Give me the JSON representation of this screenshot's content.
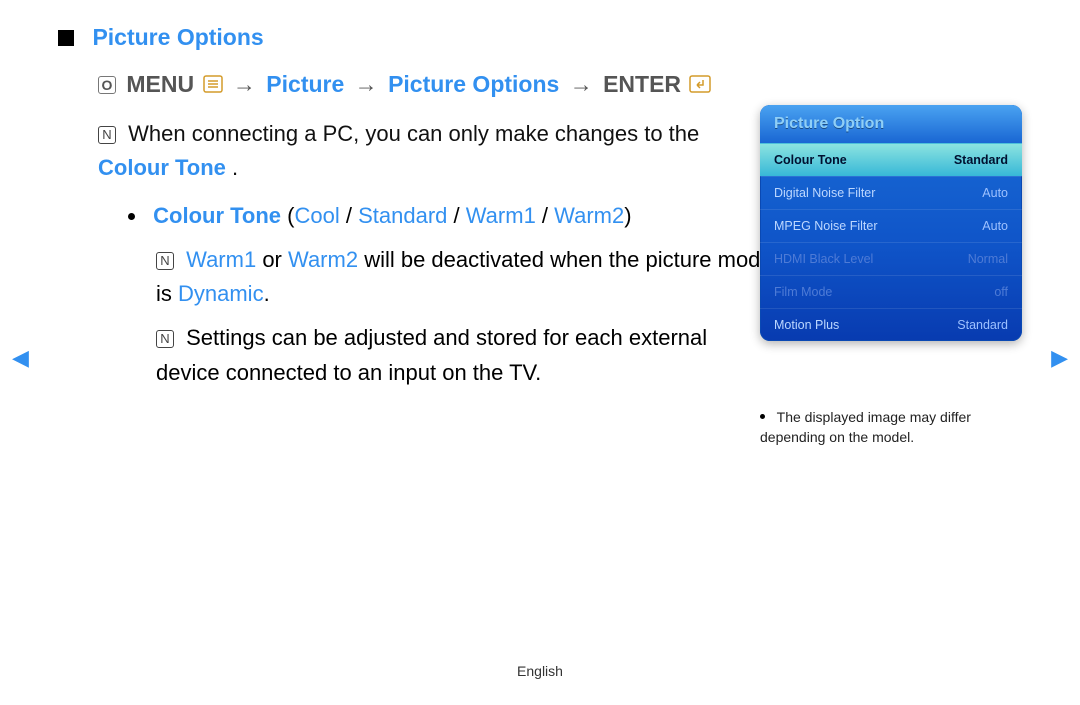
{
  "heading": "Picture Options",
  "path": {
    "menu_label": "MENU",
    "crumb1": "Picture",
    "crumb2": "Picture Options",
    "enter_label": "ENTER",
    "arrow": "→"
  },
  "note1_prefix": "When connecting a PC, you can only make changes to the ",
  "note1_highlight": "Colour Tone",
  "note1_suffix": ".",
  "bullet": {
    "label": "Colour Tone",
    "open": " (",
    "opt1": "Cool",
    "sep": " / ",
    "opt2": "Standard",
    "opt3": "Warm1",
    "opt4": "Warm2",
    "close": ")"
  },
  "sub1_a": "Warm1",
  "sub1_mid": " or ",
  "sub1_b": "Warm2",
  "sub1_rest": " will be deactivated when the picture mode is ",
  "sub1_dynamic": "Dynamic",
  "sub1_end": ".",
  "sub2": "Settings can be adjusted and stored for each external device connected to an input on the TV.",
  "panel": {
    "title": "Picture Option",
    "rows": [
      {
        "label": "Colour Tone",
        "value": "Standard",
        "selected": true,
        "dim": false
      },
      {
        "label": "Digital Noise Filter",
        "value": "Auto",
        "selected": false,
        "dim": false
      },
      {
        "label": "MPEG Noise Filter",
        "value": "Auto",
        "selected": false,
        "dim": false
      },
      {
        "label": "HDMI Black Level",
        "value": "Normal",
        "selected": false,
        "dim": true
      },
      {
        "label": "Film Mode",
        "value": "off",
        "selected": false,
        "dim": true
      },
      {
        "label": "Motion Plus",
        "value": "Standard",
        "selected": false,
        "dim": false
      }
    ]
  },
  "panel_note": "The displayed image may differ depending on the model.",
  "footer": "English",
  "icons": {
    "tool": "O",
    "note": "N"
  }
}
